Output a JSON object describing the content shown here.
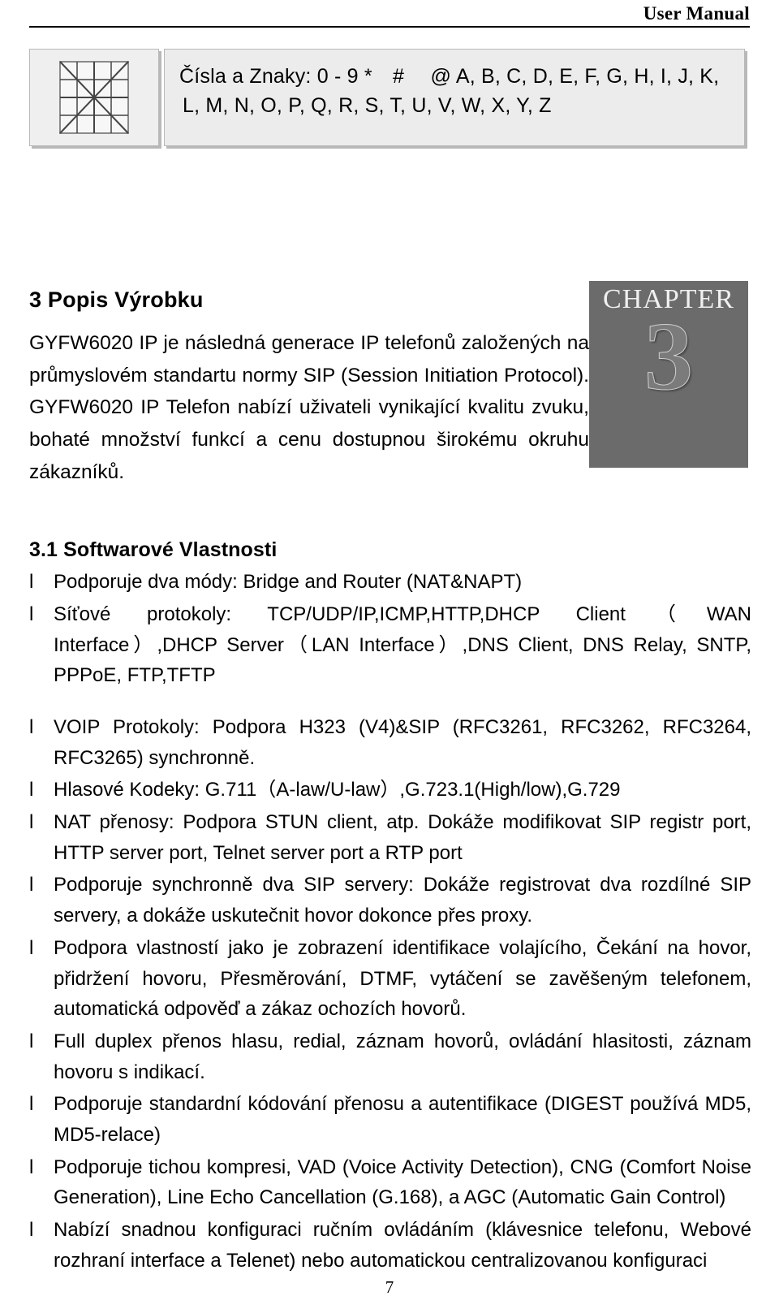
{
  "header": {
    "title": "User Manual"
  },
  "charbox": {
    "icon": "keypad-matrix-icon",
    "line1": "Čísla a Znaky: 0 - 9 *　#　 @ A, B, C, D, E, F, G, H, I, J, K,",
    "line2": "L, M, N, O, P, Q, R, S, T, U, V, W, X, Y, Z"
  },
  "chapter": {
    "caption": "CHAPTER",
    "number": "3"
  },
  "section": {
    "title": "3 Popis Výrobku",
    "intro": "GYFW6020 IP je následná generace IP telefonů založených na průmyslovém standartu normy SIP (Session Initiation Protocol). GYFW6020 IP Telefon nabízí uživateli vynikající kvalitu zvuku, bohaté množství funkcí a cenu dostupnou širokému okruhu zákazníků."
  },
  "subsection": {
    "title": "3.1 Softwarové Vlastnosti",
    "bullet": "l",
    "items": [
      {
        "text": "Podporuje dva módy: Bridge and Router (NAT&NAPT)",
        "gap": false
      },
      {
        "text": "Síťové protokoly: TCP/UDP/IP,ICMP,HTTP,DHCP Client（WAN Interface）,DHCP Server（LAN Interface）,DNS Client, DNS Relay, SNTP, PPPoE, FTP,TFTP",
        "gap": false
      },
      {
        "text": "VOIP Protokoly: Podpora H323 (V4)&SIP (RFC3261, RFC3262, RFC3264, RFC3265) synchronně.",
        "gap": true
      },
      {
        "text": "Hlasové Kodeky: G.711（A-law/U-law）,G.723.1(High/low),G.729",
        "gap": false
      },
      {
        "text": "NAT přenosy: Podpora STUN client, atp. Dokáže modifikovat SIP registr port, HTTP server port, Telnet server port a RTP port",
        "gap": false
      },
      {
        "text": "Podporuje synchronně dva SIP servery: Dokáže registrovat dva rozdílné SIP servery, a dokáže uskutečnit hovor dokonce přes proxy.",
        "gap": false
      },
      {
        "text": "Podpora vlastností jako je zobrazení identifikace volajícího, Čekání na hovor, přidržení hovoru, Přesměrování, DTMF, vytáčení se zavěšeným telefonem, automatická odpověď a zákaz ochozích hovorů.",
        "gap": false
      },
      {
        "text": "Full duplex přenos hlasu, redial, záznam hovorů, ovládání hlasitosti, záznam hovoru s indikací.",
        "gap": false
      },
      {
        "text": "Podporuje standardní kódování přenosu a autentifikace (DIGEST používá MD5, MD5-relace)",
        "gap": false
      },
      {
        "text": "Podporuje tichou kompresi, VAD (Voice Activity Detection), CNG (Comfort Noise Generation), Line Echo Cancellation (G.168), a AGC (Automatic Gain Control)",
        "gap": false
      },
      {
        "text": "Nabízí snadnou konfiguraci ručním ovládáním (klávesnice telefonu, Webové rozhraní interface a Telenet) nebo automatickou centralizovanou konfiguraci",
        "gap": false
      }
    ]
  },
  "footer": {
    "page_number": "7"
  }
}
